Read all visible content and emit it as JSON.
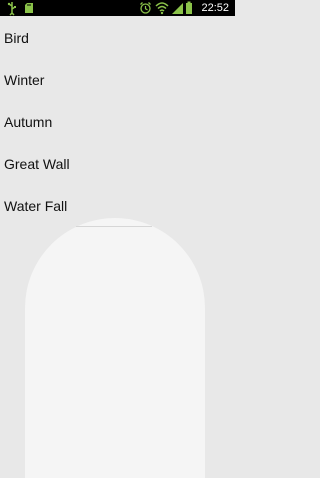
{
  "status_bar": {
    "time": "22:52",
    "icons": [
      "usb-icon",
      "sd-card-icon",
      "alarm-clock-icon",
      "wifi-icon",
      "signal-icon",
      "battery-icon"
    ],
    "icon_color": "#8bc34a"
  },
  "list": {
    "items": [
      {
        "label": "Bird"
      },
      {
        "label": "Winter"
      },
      {
        "label": "Autumn"
      },
      {
        "label": "Great Wall"
      },
      {
        "label": "Water Fall"
      }
    ]
  }
}
